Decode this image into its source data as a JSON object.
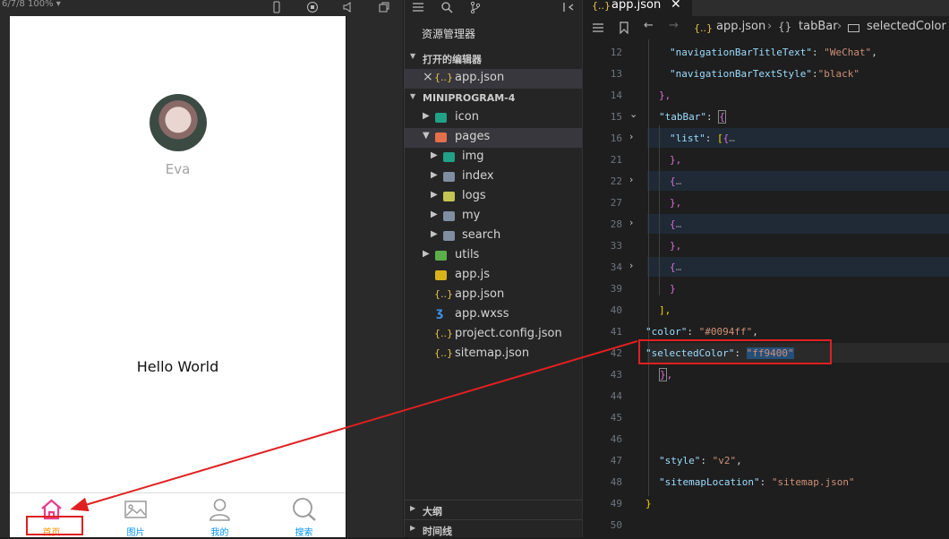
{
  "simulator": {
    "device_info": "6/7/8 100% ▾",
    "username": "Eva",
    "hello": "Hello World",
    "tabs": [
      {
        "label": "首页",
        "icon": "home-icon",
        "color": "#ff9400"
      },
      {
        "label": "图片",
        "icon": "image-icon",
        "color": "#0094ff"
      },
      {
        "label": "我的",
        "icon": "user-icon",
        "color": "#0094ff"
      },
      {
        "label": "搜索",
        "icon": "search-icon",
        "color": "#0094ff"
      }
    ]
  },
  "explorer": {
    "title": "资源管理器",
    "open_editors_label": "打开的编辑器",
    "open_file": "app.json",
    "project_label": "MINIPROGRAM-4",
    "tree": [
      {
        "label": "icon",
        "type": "folder"
      },
      {
        "label": "pages",
        "type": "folder"
      },
      {
        "label": "img",
        "type": "folder"
      },
      {
        "label": "index",
        "type": "folder"
      },
      {
        "label": "logs",
        "type": "folder"
      },
      {
        "label": "my",
        "type": "folder"
      },
      {
        "label": "search",
        "type": "folder"
      },
      {
        "label": "utils",
        "type": "folder"
      },
      {
        "label": "app.js",
        "type": "file"
      },
      {
        "label": "app.json",
        "type": "file"
      },
      {
        "label": "app.wxss",
        "type": "file"
      },
      {
        "label": "project.config.json",
        "type": "file"
      },
      {
        "label": "sitemap.json",
        "type": "file"
      }
    ],
    "outline_label": "大纲",
    "timeline_label": "时间线"
  },
  "editor": {
    "tab_label": "app.json",
    "breadcrumb": {
      "file": "app.json",
      "object": "tabBar",
      "prop": "selectedColor"
    },
    "line_numbers": [
      "12",
      "13",
      "14",
      "15",
      "16",
      "21",
      "22",
      "27",
      "28",
      "33",
      "34",
      "39",
      "40",
      "41",
      "42",
      "43",
      "44",
      "45",
      "46",
      "47",
      "48",
      "49",
      "50"
    ],
    "code": {
      "l12_key": "\"navigationBarTitleText\"",
      "l12_val": "\"WeChat\"",
      "l13_key": "\"navigationBarTextStyle\"",
      "l13_val": "\"black\"",
      "l15_key": "\"tabBar\"",
      "l16_key": "\"list\"",
      "l41_key": "\"color\"",
      "l41_val": "\"#0094ff\"",
      "l42_key": "\"selectedColor\"",
      "l42_val": "\"ff9400\"",
      "l47_key": "\"style\"",
      "l47_val": "\"v2\"",
      "l48_key": "\"sitemapLocation\"",
      "l48_val": "\"sitemap.json\""
    },
    "annotation_color": "#e02020"
  }
}
